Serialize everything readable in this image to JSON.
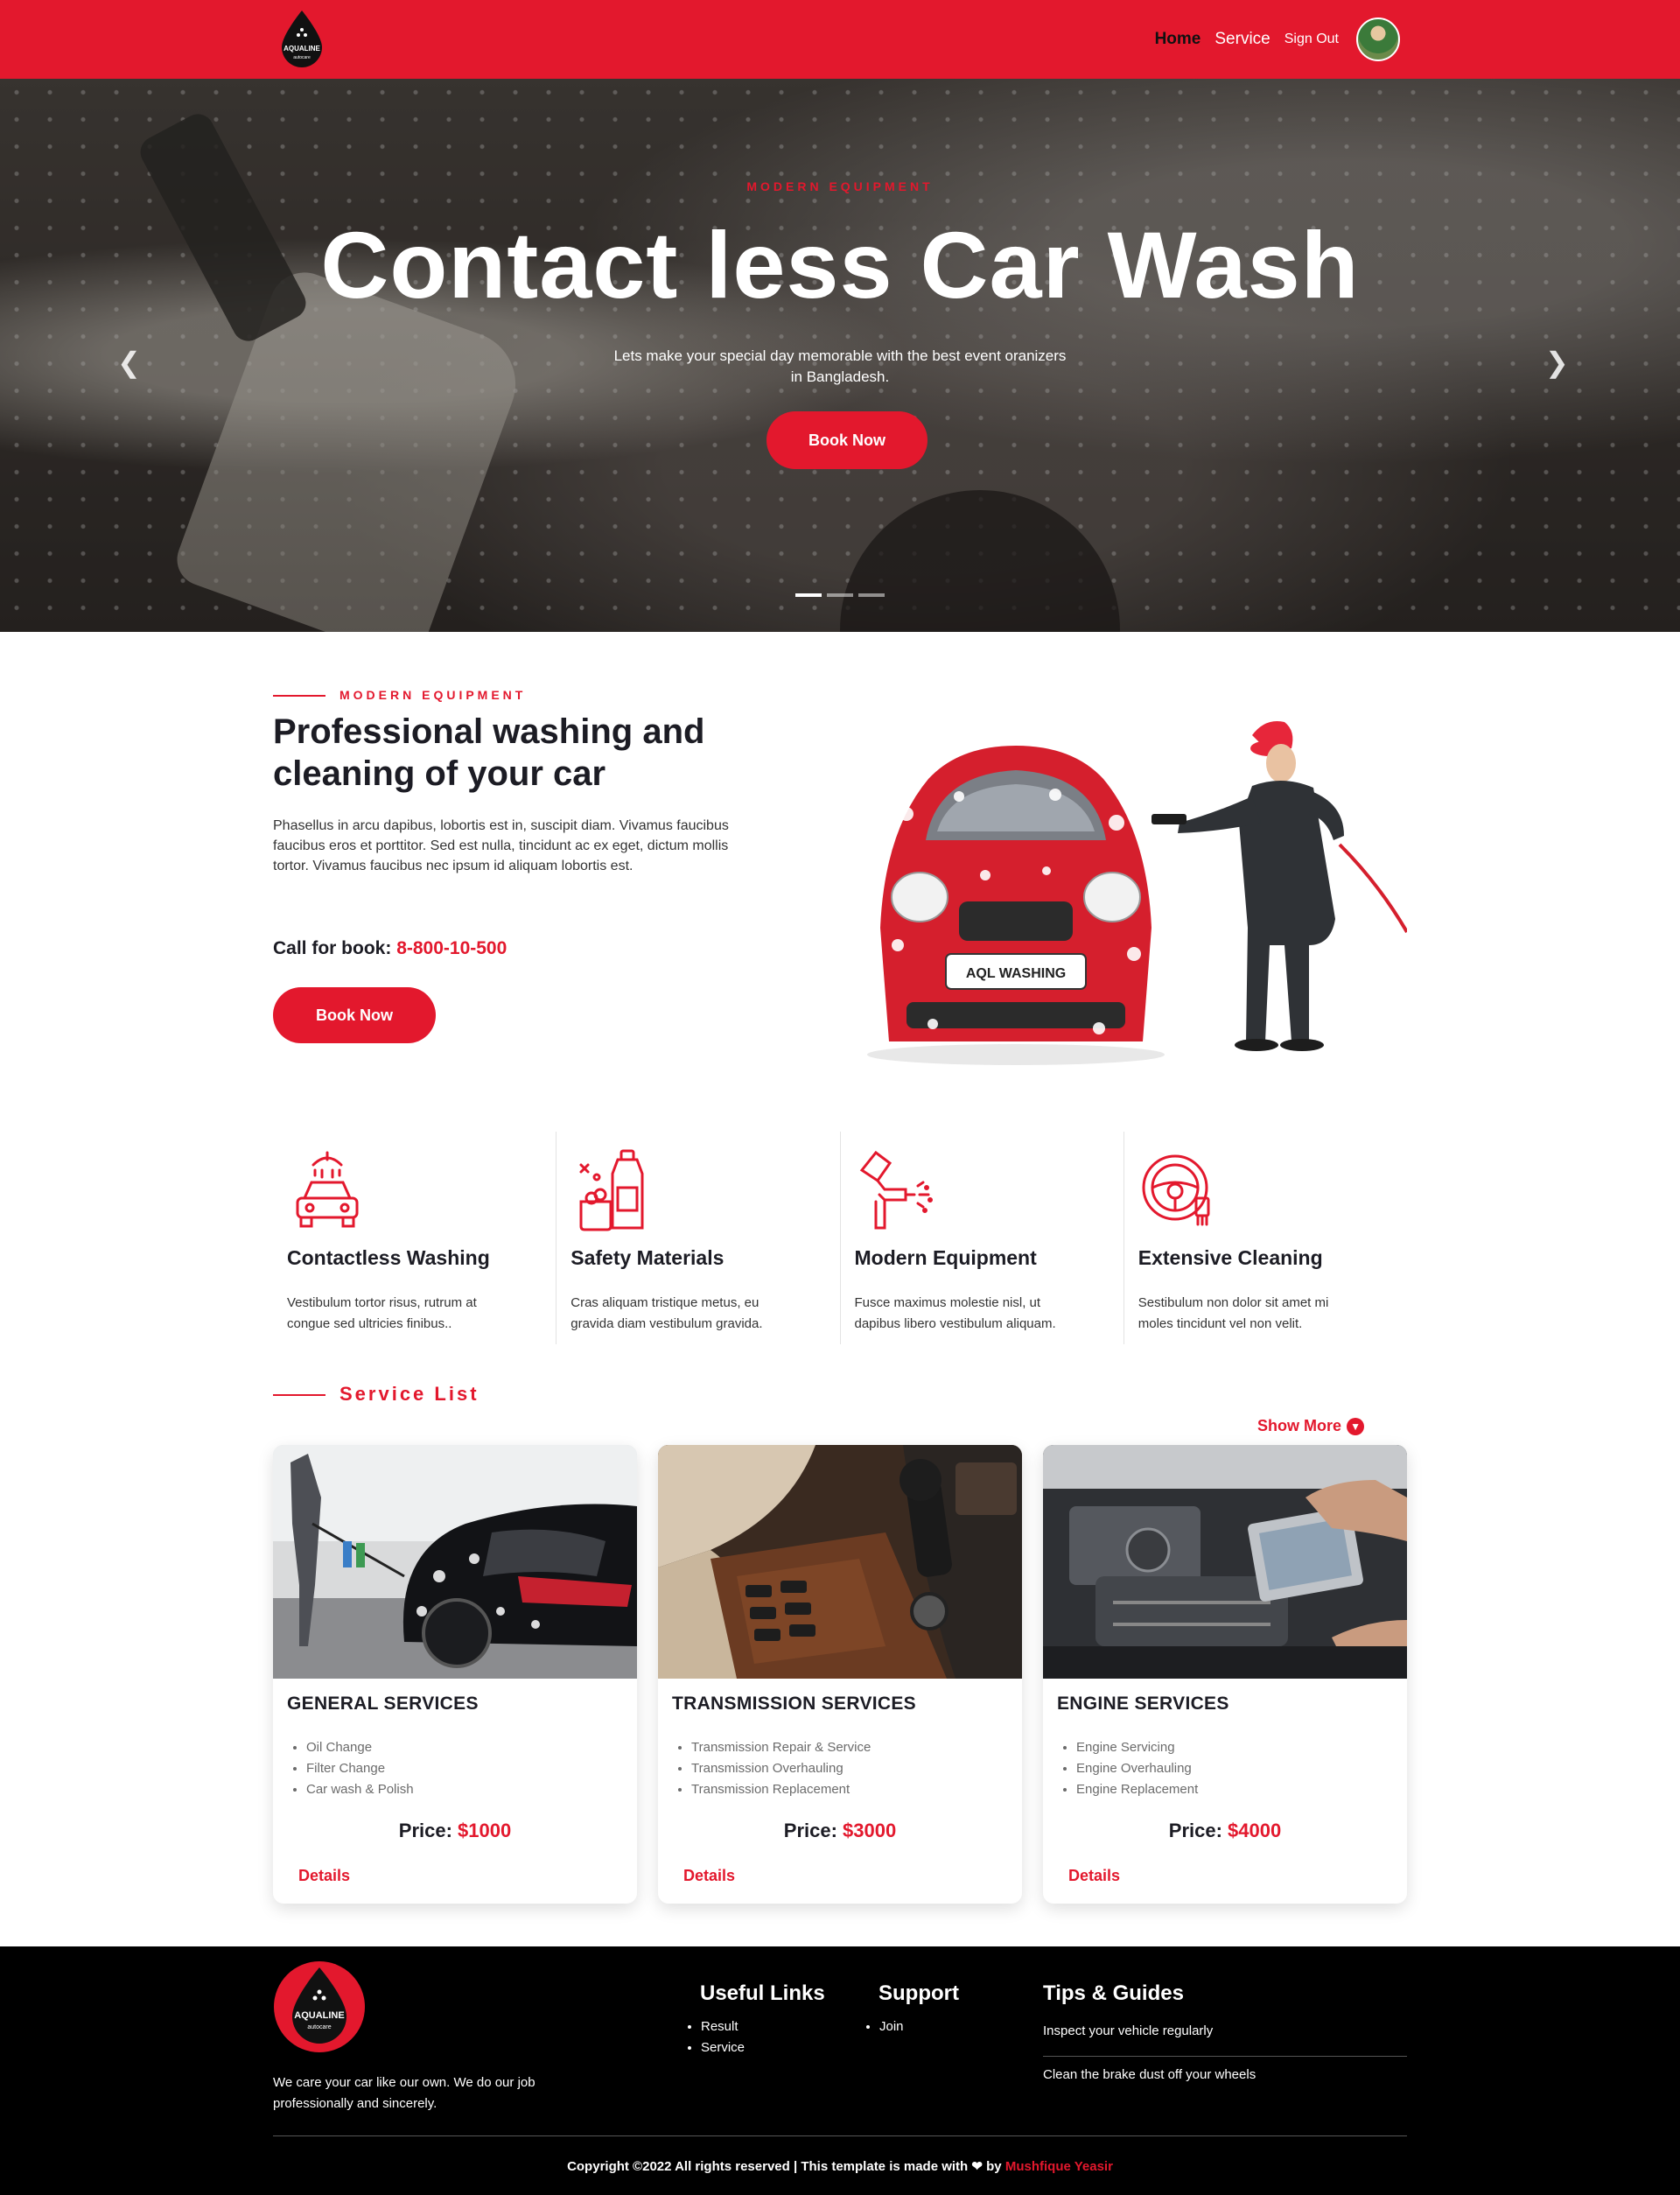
{
  "nav": {
    "logo_text": "AQUALINE",
    "logo_sub": "autocare",
    "links": [
      "Home",
      "Service",
      "Sign Out"
    ]
  },
  "hero": {
    "eyebrow": "MODERN EQUIPMENT",
    "title": "Contact less Car Wash",
    "subtitle": "Lets make your special day memorable with the best event oranizers in Bangladesh.",
    "button": "Book Now",
    "prev_icon": "chevron-left-icon",
    "next_icon": "chevron-right-icon",
    "slides": 3,
    "active_slide": 1
  },
  "about": {
    "eyebrow": "MODERN EQUIPMENT",
    "title": "Professional washing and cleaning of your car",
    "text": "Phasellus in arcu dapibus, lobortis est in, suscipit diam. Vivamus faucibus faucibus eros et porttitor. Sed est nulla, tincidunt ac ex eget, dictum mollis tortor. Vivamus faucibus nec ipsum id aliquam lobortis est.",
    "call_label": "Call for book:",
    "call_number": "8-800-10-500",
    "button": "Book Now",
    "plate_text": "AQL WASHING"
  },
  "features": [
    {
      "icon": "car-wash-icon",
      "title": "Contactless Washing",
      "text": "Vestibulum tortor risus, rutrum at congue sed ultricies finibus.."
    },
    {
      "icon": "cleaning-bottles-icon",
      "title": "Safety Materials",
      "text": "Cras aliquam tristique metus, eu gravida diam vestibulum gravida."
    },
    {
      "icon": "spray-gun-icon",
      "title": "Modern Equipment",
      "text": "Fusce maximus molestie nisl, ut dapibus libero vestibulum aliquam."
    },
    {
      "icon": "steering-wheel-icon",
      "title": "Extensive Cleaning",
      "text": "Sestibulum non dolor sit amet mi moles tincidunt vel non velit."
    }
  ],
  "services": {
    "heading": "Service List",
    "show_more": "Show More",
    "cards": [
      {
        "title": "GENERAL SERVICES",
        "items": [
          "Oil Change",
          "Filter Change",
          "Car wash & Polish"
        ],
        "price_label": "Price:",
        "price": "$1000",
        "details": "Details"
      },
      {
        "title": "TRANSMISSION SERVICES",
        "items": [
          "Transmission Repair & Service",
          "Transmission Overhauling",
          "Transmission Replacement"
        ],
        "price_label": "Price:",
        "price": "$3000",
        "details": "Details"
      },
      {
        "title": "ENGINE SERVICES",
        "items": [
          "Engine Servicing",
          "Engine Overhauling",
          "Engine Replacement"
        ],
        "price_label": "Price:",
        "price": "$4000",
        "details": "Details"
      }
    ]
  },
  "footer": {
    "logo_text": "AQUALINE",
    "logo_sub": "autocare",
    "tagline": "We care your car like our own. We do our job professionally and sincerely.",
    "useful_links_title": "Useful Links",
    "useful_links": [
      "Result",
      "Service"
    ],
    "support_title": "Support",
    "support_links": [
      "Join"
    ],
    "tips_title": "Tips & Guides",
    "tips": [
      "Inspect your vehicle regularly",
      "Clean the brake dust off your wheels"
    ],
    "copyright": "Copyright ©2022 All rights reserved | This template is made with",
    "by": "by",
    "author": "Mushfique Yeasir"
  },
  "colors": {
    "accent": "#e3182d",
    "footer_bg": "#000000"
  }
}
